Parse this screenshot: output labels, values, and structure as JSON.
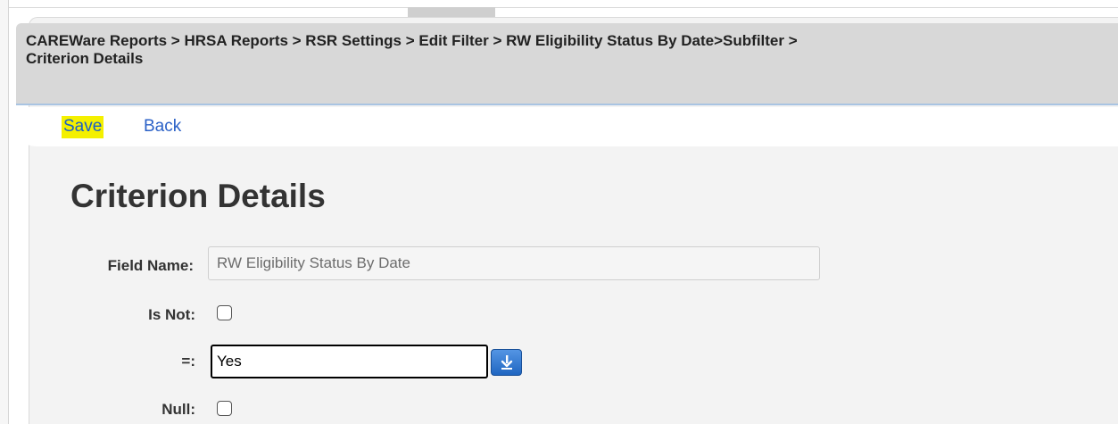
{
  "breadcrumb": {
    "line1": "CAREWare Reports > HRSA Reports > RSR Settings > Edit Filter > RW Eligibility Status By Date>Subfilter >",
    "line2": "Criterion Details"
  },
  "toolbar": {
    "save_label": "Save",
    "back_label": "Back"
  },
  "page": {
    "title": "Criterion Details"
  },
  "fields": {
    "field_name_label": "Field Name:",
    "field_name_value": "RW Eligibility Status By Date",
    "is_not_label": "Is Not:",
    "equals_label": "=:",
    "equals_value": "Yes",
    "null_label": "Null:"
  },
  "colors": {
    "link": "#2b61c7",
    "save_highlight": "#f4f000",
    "breadcrumb_bg": "#d8d8d8",
    "dropdown_button": "#2f7be0"
  },
  "icons": {
    "dropdown": "download-arrow-icon"
  }
}
